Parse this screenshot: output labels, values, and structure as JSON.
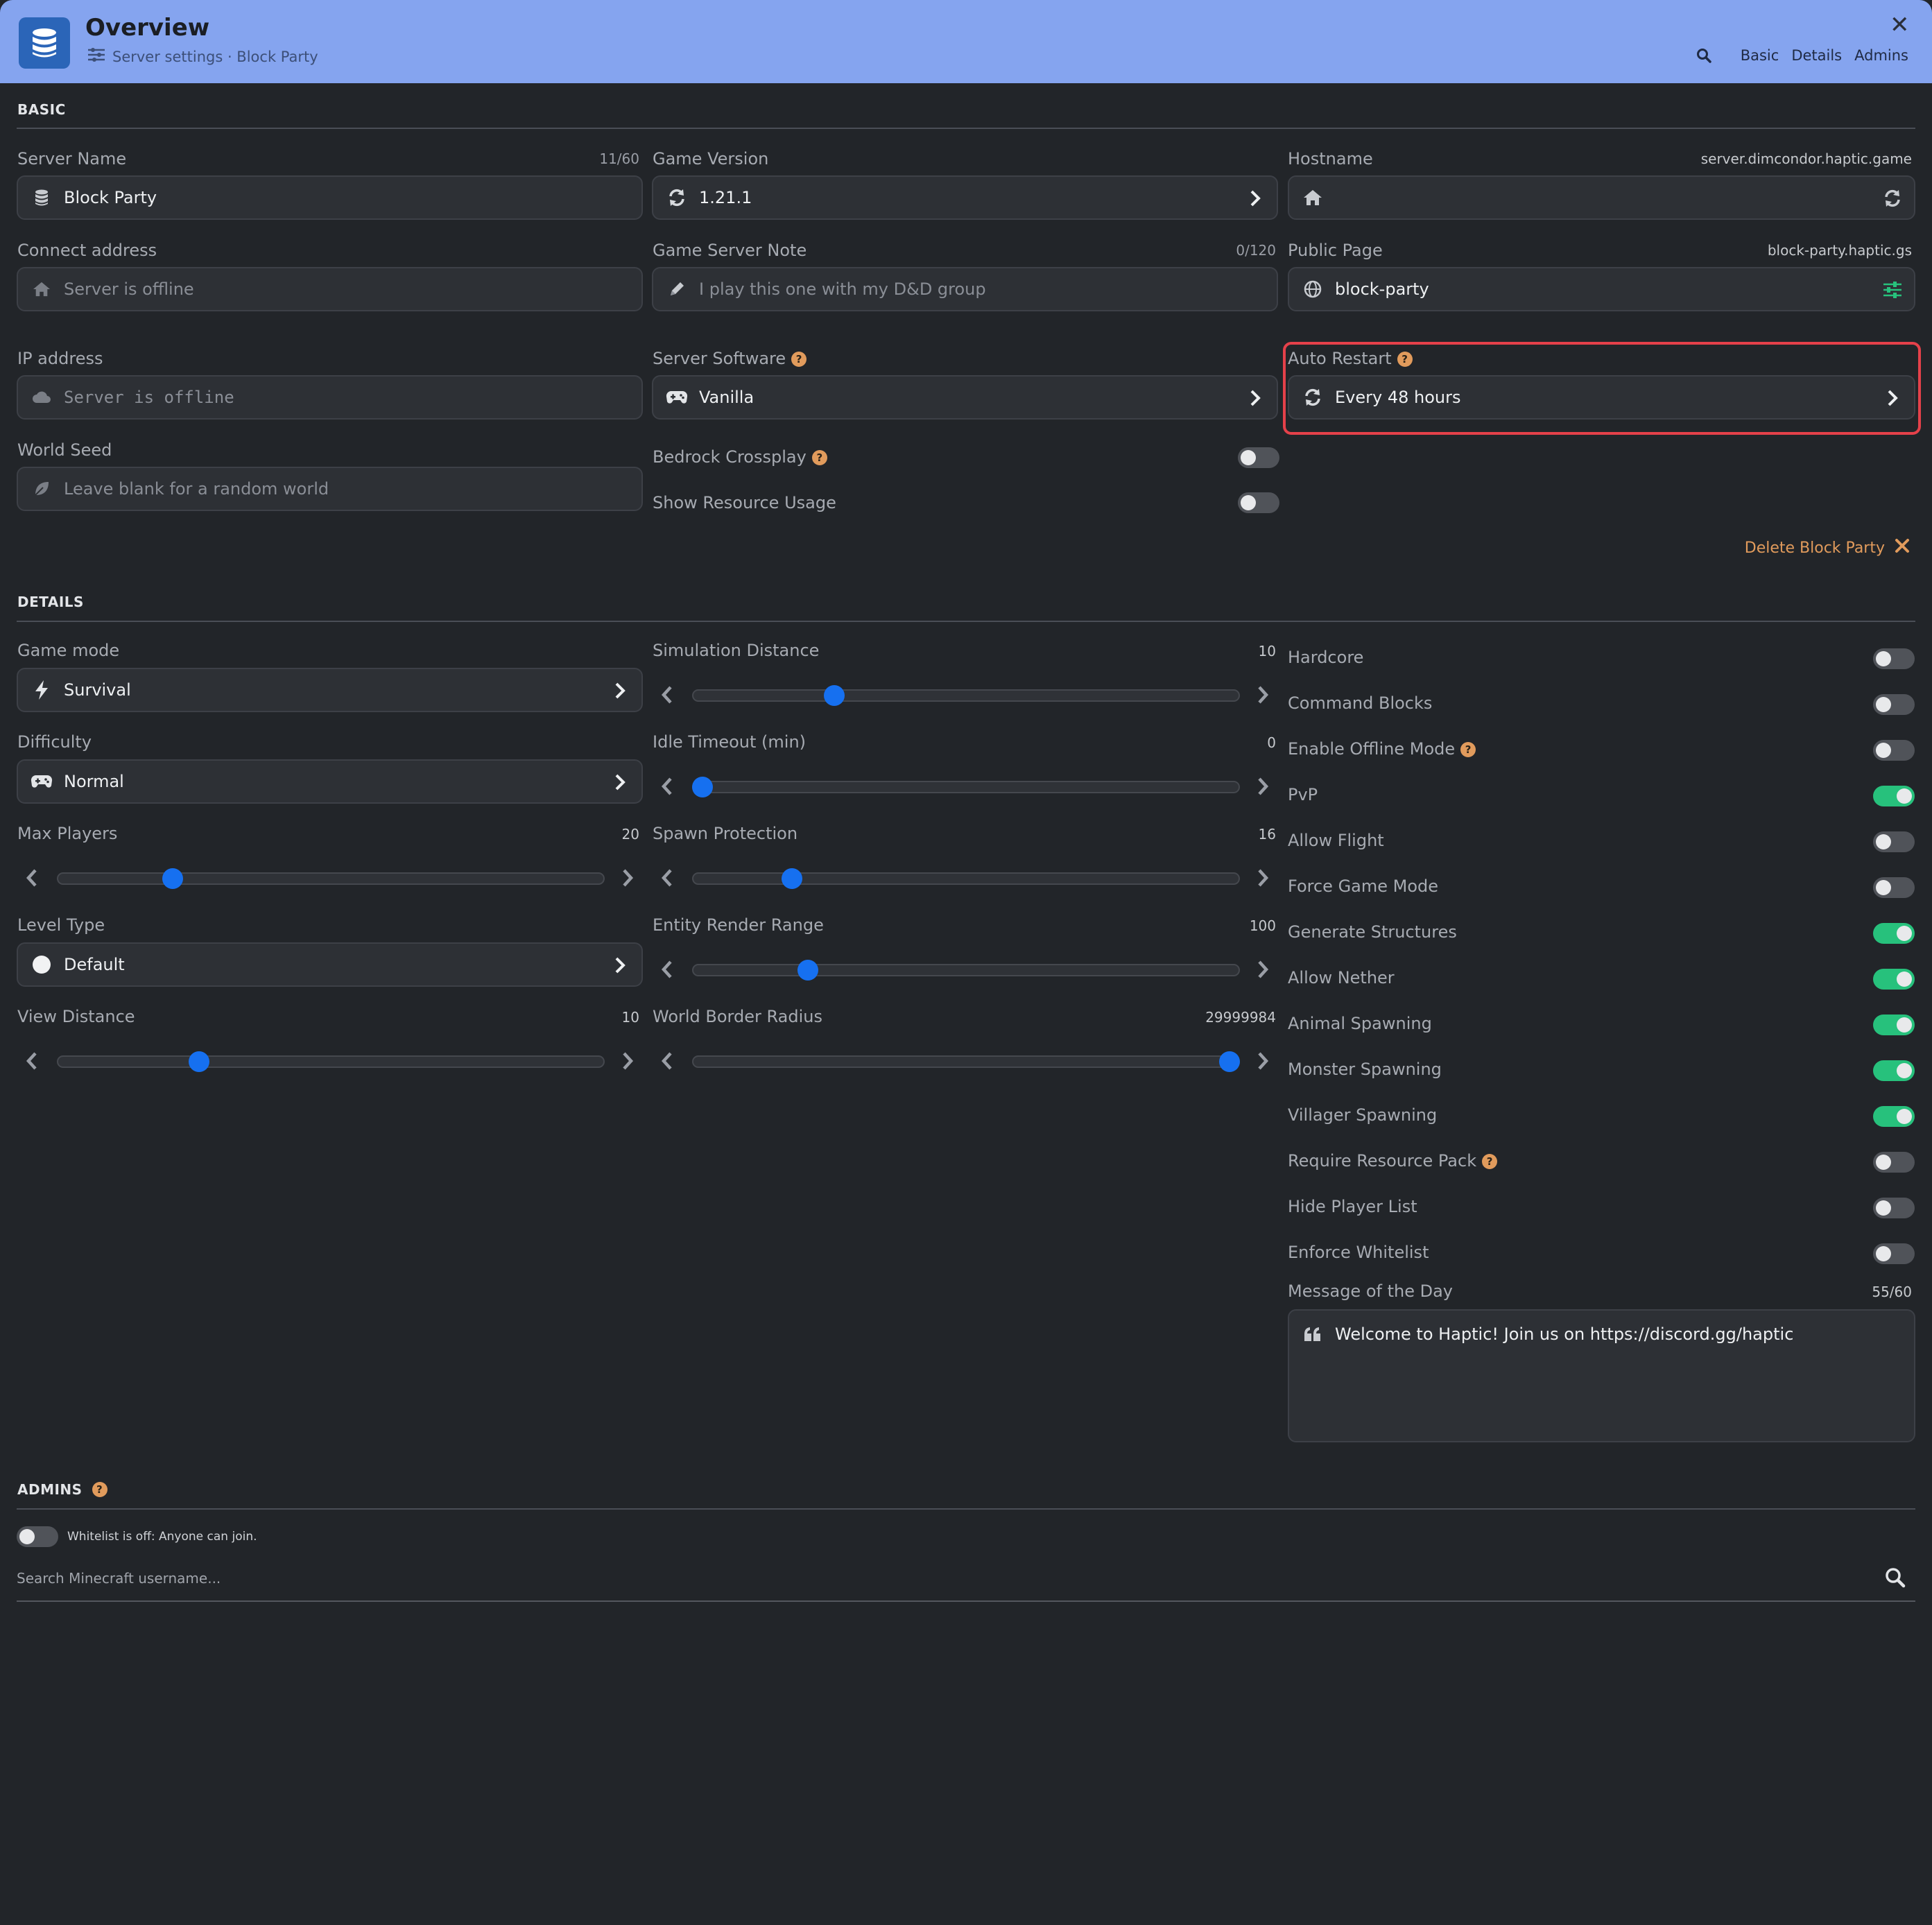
{
  "header": {
    "title": "Overview",
    "subtitle": "Server settings · Block Party",
    "nav": [
      "Basic",
      "Details",
      "Admins"
    ],
    "accent_color": "#85a4ef"
  },
  "basic": {
    "section_title": "BASIC",
    "server_name": {
      "label": "Server Name",
      "count": "11/60",
      "value": "Block Party",
      "icon": "database-icon"
    },
    "game_version": {
      "label": "Game Version",
      "value": "1.21.1",
      "icon": "refresh-icon"
    },
    "hostname": {
      "label": "Hostname",
      "hint": "server.dimcondor.haptic.game",
      "value": "",
      "icon": "home-icon"
    },
    "connect_address": {
      "label": "Connect address",
      "placeholder": "Server is offline",
      "icon": "home-icon"
    },
    "game_server_note": {
      "label": "Game Server Note",
      "count": "0/120",
      "placeholder": "I play this one with my D&D group",
      "icon": "pencil-icon"
    },
    "public_page": {
      "label": "Public Page",
      "hint": "block-party.haptic.gs",
      "value": "block-party",
      "icon": "globe-icon"
    },
    "ip_address": {
      "label": "IP address",
      "placeholder": "Server is offline",
      "icon": "cloud-icon"
    },
    "server_software": {
      "label": "Server Software",
      "value": "Vanilla",
      "icon": "gamepad-icon"
    },
    "auto_restart": {
      "label": "Auto Restart",
      "value": "Every 48 hours",
      "icon": "refresh-icon"
    },
    "world_seed": {
      "label": "World Seed",
      "placeholder": "Leave blank for a random world",
      "icon": "leaf-icon"
    },
    "bedrock_crossplay": {
      "label": "Bedrock Crossplay",
      "on": false
    },
    "show_resource_usage": {
      "label": "Show Resource Usage",
      "on": false
    },
    "delete_label": "Delete Block Party"
  },
  "details": {
    "section_title": "DETAILS",
    "game_mode": {
      "label": "Game mode",
      "value": "Survival",
      "icon": "bolt-icon"
    },
    "difficulty": {
      "label": "Difficulty",
      "value": "Normal",
      "icon": "gamepad-icon"
    },
    "max_players": {
      "label": "Max Players",
      "value": "20",
      "fraction": 0.2
    },
    "level_type": {
      "label": "Level Type",
      "value": "Default",
      "icon": "circle-icon"
    },
    "view_distance": {
      "label": "View Distance",
      "value": "10",
      "fraction": 0.25
    },
    "simulation_distance": {
      "label": "Simulation Distance",
      "value": "10",
      "fraction": 0.25
    },
    "idle_timeout": {
      "label": "Idle Timeout (min)",
      "value": "0",
      "fraction": 0.0
    },
    "spawn_protection": {
      "label": "Spawn Protection",
      "value": "16",
      "fraction": 0.17
    },
    "entity_render_range": {
      "label": "Entity Render Range",
      "value": "100",
      "fraction": 0.2
    },
    "world_border_radius": {
      "label": "World Border Radius",
      "value": "29999984",
      "fraction": 1.0
    },
    "toggles": [
      {
        "label": "Hardcore",
        "on": false,
        "help": false
      },
      {
        "label": "Command Blocks",
        "on": false,
        "help": false
      },
      {
        "label": "Enable Offline Mode",
        "on": false,
        "help": true
      },
      {
        "label": "PvP",
        "on": true,
        "help": false
      },
      {
        "label": "Allow Flight",
        "on": false,
        "help": false
      },
      {
        "label": "Force Game Mode",
        "on": false,
        "help": false
      },
      {
        "label": "Generate Structures",
        "on": true,
        "help": false
      },
      {
        "label": "Allow Nether",
        "on": true,
        "help": false
      },
      {
        "label": "Animal Spawning",
        "on": true,
        "help": false
      },
      {
        "label": "Monster Spawning",
        "on": true,
        "help": false
      },
      {
        "label": "Villager Spawning",
        "on": true,
        "help": false
      },
      {
        "label": "Require Resource Pack",
        "on": false,
        "help": true
      },
      {
        "label": "Hide Player List",
        "on": false,
        "help": false
      },
      {
        "label": "Enforce Whitelist",
        "on": false,
        "help": false
      }
    ],
    "motd": {
      "label": "Message of the Day",
      "count": "55/60",
      "value": "Welcome to Haptic! Join us on https://discord.gg/haptic",
      "icon": "quote-icon"
    }
  },
  "admins": {
    "section_title": "ADMINS",
    "whitelist_note": "Whitelist is off: Anyone can join.",
    "whitelist_on": false,
    "search_placeholder": "Search Minecraft username..."
  },
  "colors": {
    "toggle_on": "#27c17c",
    "slider_thumb": "#1670f0",
    "help_badge": "#e19b5c",
    "highlight": "#e5414a"
  }
}
